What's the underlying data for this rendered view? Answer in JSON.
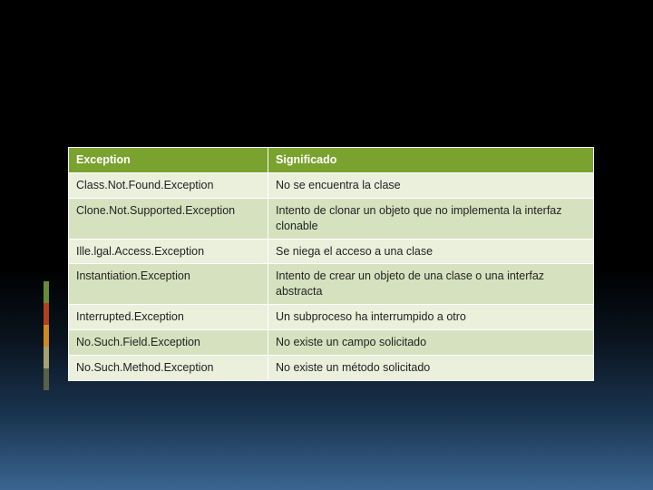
{
  "table": {
    "headers": [
      "Exception",
      "Significado"
    ],
    "rows": [
      {
        "exception": "Class.Not.Found.Exception",
        "meaning": "No se encuentra la clase"
      },
      {
        "exception": "Clone.Not.Supported.Exception",
        "meaning": "Intento de clonar un objeto que no implementa la interfaz clonable"
      },
      {
        "exception": "Ille.lgal.Access.Exception",
        "meaning": "Se niega el acceso a una clase"
      },
      {
        "exception": "Instantiation.Exception",
        "meaning": "Intento de crear un objeto de una clase o una interfaz abstracta"
      },
      {
        "exception": "Interrupted.Exception",
        "meaning": "Un subproceso ha interrumpido a otro"
      },
      {
        "exception": "No.Such.Field.Exception",
        "meaning": "No existe un campo solicitado"
      },
      {
        "exception": "No.Such.Method.Exception",
        "meaning": "No existe un método solicitado"
      }
    ]
  },
  "accent_colors": [
    "#6a8a3a",
    "#b04020",
    "#d08820",
    "#a8a070",
    "#586048"
  ]
}
